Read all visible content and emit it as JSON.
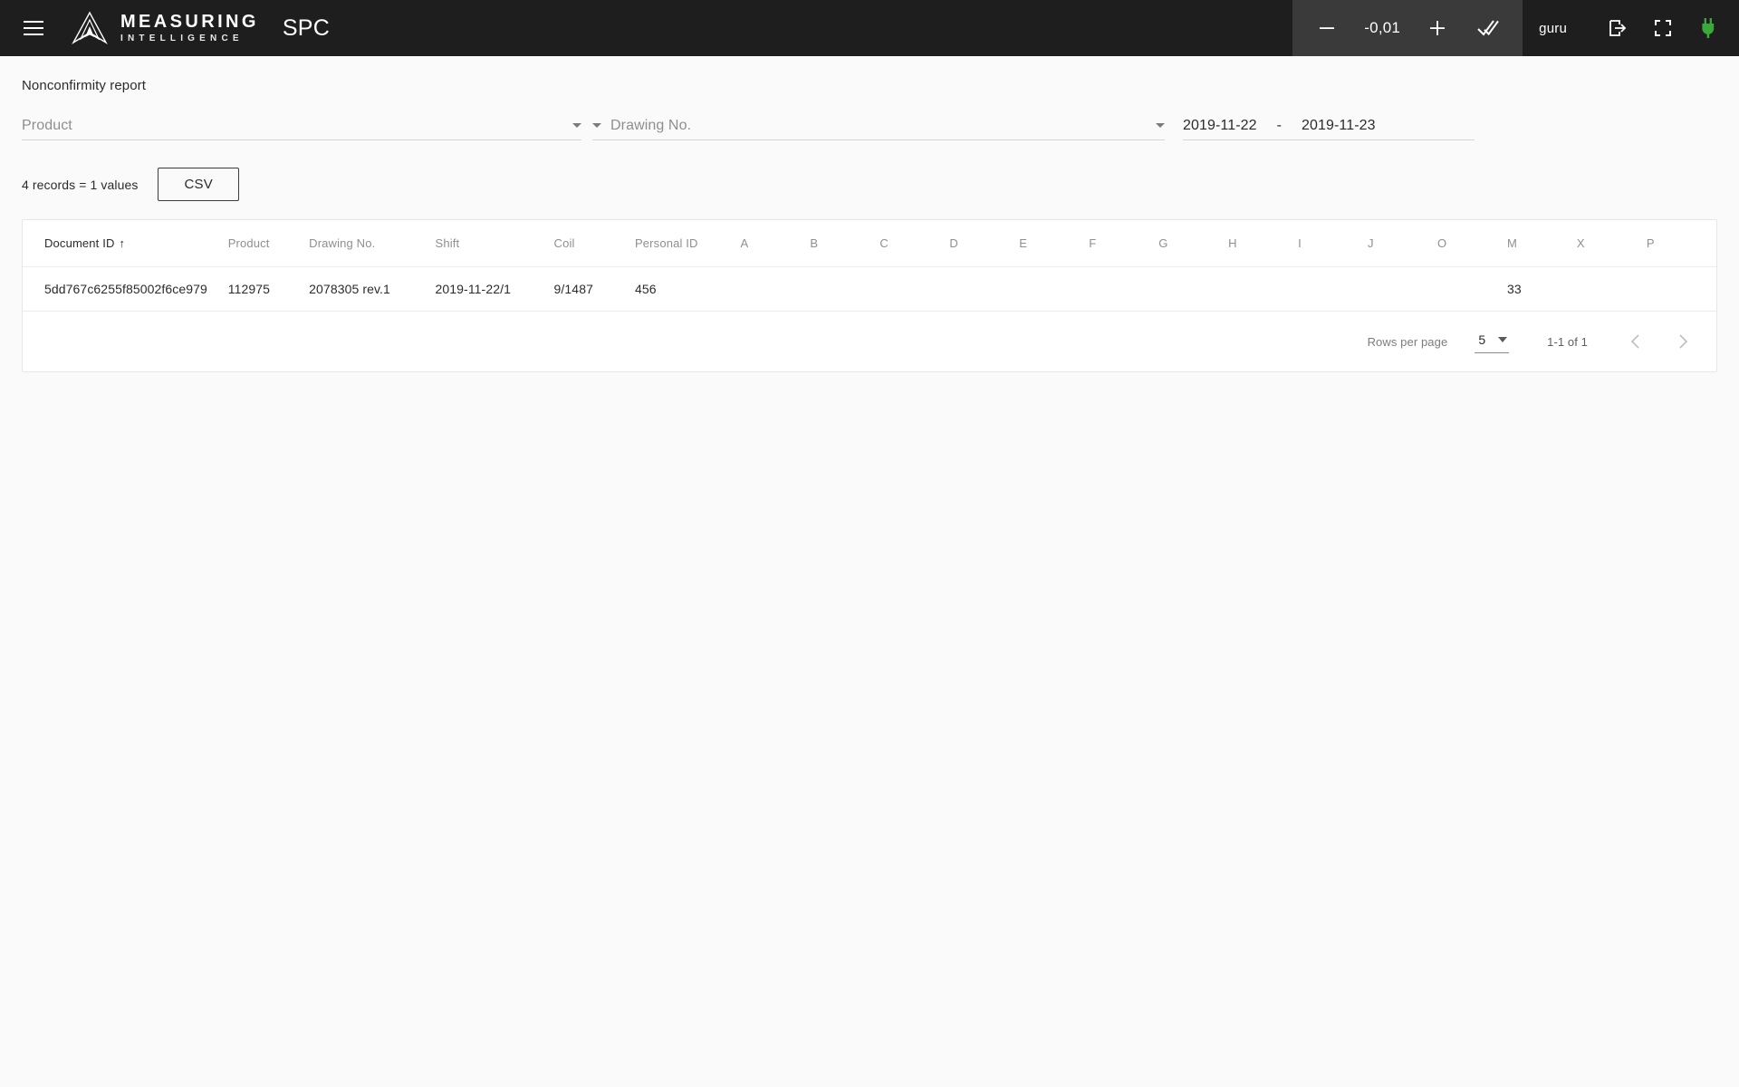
{
  "appbar": {
    "menu_icon": "hamburger-icon",
    "logo_icon": "measuring-intelligence-logo",
    "brand_line1": "MEASURING",
    "brand_line2": "INTELLIGENCE",
    "app_name": "SPC",
    "stepper": {
      "minus_icon": "minus-icon",
      "value": "-0,01",
      "plus_icon": "plus-icon",
      "confirm_icon": "double-check-icon"
    },
    "user": {
      "name": "guru",
      "login_icon": "login-arrow-icon",
      "fullscreen_icon": "fullscreen-icon",
      "plug_icon": "plug-icon",
      "plug_color": "#3aa83a"
    }
  },
  "page": {
    "title": "Nonconfirmity report"
  },
  "filters": {
    "product_label": "Product",
    "drawing_label": "Drawing No.",
    "date_from": "2019-11-22",
    "date_separator": "-",
    "date_to": "2019-11-23"
  },
  "records": {
    "summary": "4 records = 1 values",
    "csv_label": "CSV"
  },
  "table": {
    "columns": [
      "Document ID",
      "Product",
      "Drawing No.",
      "Shift",
      "Coil",
      "Personal ID",
      "A",
      "B",
      "C",
      "D",
      "E",
      "F",
      "G",
      "H",
      "I",
      "J",
      "O",
      "M",
      "X",
      "P"
    ],
    "sorted_column": "Document ID",
    "sort_arrow": "↑",
    "rows": [
      {
        "document_id": "5dd767c6255f85002f6ce979",
        "product": "112975",
        "drawing_no": "2078305 rev.1",
        "shift": "2019-11-22/1",
        "coil": "9/1487",
        "personal_id": "456",
        "A": "",
        "B": "",
        "C": "",
        "D": "",
        "E": "",
        "F": "",
        "G": "",
        "H": "",
        "I": "",
        "J": "",
        "O": "",
        "M": "33",
        "X": "",
        "P": ""
      }
    ]
  },
  "pagination": {
    "rows_per_page_label": "Rows per page",
    "rows_per_page_value": "5",
    "range_text": "1-1 of 1",
    "prev_icon": "chevron-left-icon",
    "next_icon": "chevron-right-icon"
  }
}
